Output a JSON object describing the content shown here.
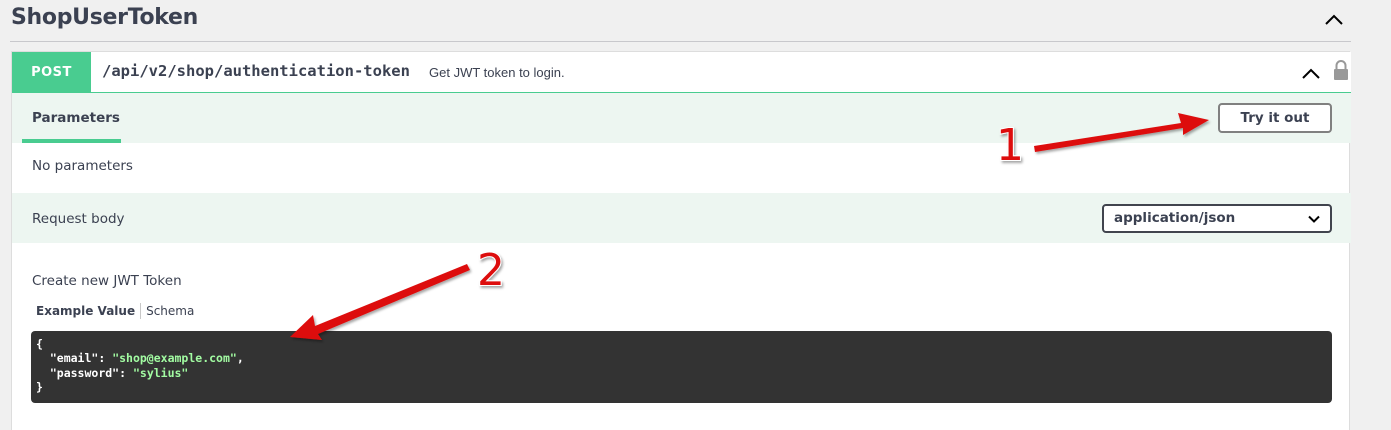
{
  "tag": {
    "title": "ShopUserToken"
  },
  "operation": {
    "method": "POST",
    "path": "/api/v2/shop/authentication-token",
    "summary": "Get JWT token to login.",
    "method_color": "#49cc90"
  },
  "parameters": {
    "tab_label": "Parameters",
    "try_button": "Try it out",
    "empty_text": "No parameters"
  },
  "request_body": {
    "label": "Request body",
    "content_type": "application/json",
    "description": "Create new JWT Token",
    "tabs": {
      "example": "Example Value",
      "schema": "Schema"
    },
    "example": {
      "open_brace": "{",
      "close_brace": "}",
      "email_key": "\"email\"",
      "email_value": "\"shop@example.com\"",
      "password_key": "\"password\"",
      "password_value": "\"sylius\""
    }
  },
  "annotations": {
    "marker_1": "1",
    "marker_2": "2",
    "arrow_color": "#dd1111"
  },
  "icons": {
    "tag_toggle": "chevron-up-icon",
    "collapse": "chevron-up-icon",
    "lock": "lock-icon",
    "select": "chevron-down-icon"
  }
}
